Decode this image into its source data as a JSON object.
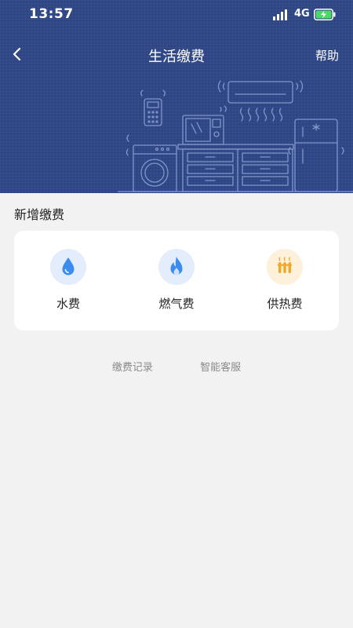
{
  "status_bar": {
    "time": "13:57",
    "network": "4G",
    "icons": [
      "signal-icon",
      "battery-charging-icon"
    ]
  },
  "header": {
    "title": "生活缴费",
    "help_label": "帮助",
    "back_icon": "chevron-left-icon",
    "background_color": "#2e4585"
  },
  "section": {
    "title": "新增缴费"
  },
  "payment_types": [
    {
      "label": "水费",
      "icon": "water-drop-icon",
      "color": "#3c8cf0"
    },
    {
      "label": "燃气费",
      "icon": "flame-icon",
      "color": "#3c8cf0"
    },
    {
      "label": "供热费",
      "icon": "heating-radiator-icon",
      "color": "#f0a825"
    }
  ],
  "footer_links": {
    "records": "缴费记录",
    "service": "智能客服"
  }
}
